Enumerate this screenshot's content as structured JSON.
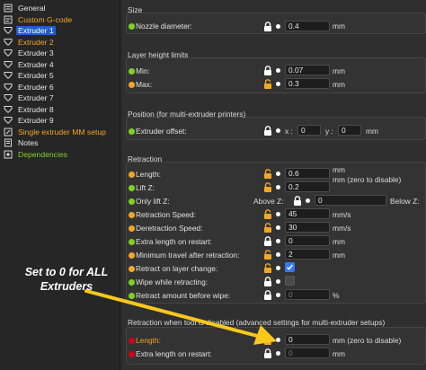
{
  "sidebar": {
    "items": [
      {
        "label": "General",
        "color": "#e6e6e6",
        "icon": "gear-icon"
      },
      {
        "label": "Custom G-code",
        "color": "#f5a623",
        "icon": "gcode-icon"
      },
      {
        "label": "Extruder 1",
        "color": "#ffffff",
        "icon": "extruder-icon",
        "selected": true
      },
      {
        "label": "Extruder 2",
        "color": "#f5a623",
        "icon": "extruder-icon"
      },
      {
        "label": "Extruder 3",
        "color": "#e6e6e6",
        "icon": "extruder-icon"
      },
      {
        "label": "Extruder 4",
        "color": "#e6e6e6",
        "icon": "extruder-icon"
      },
      {
        "label": "Extruder 5",
        "color": "#e6e6e6",
        "icon": "extruder-icon"
      },
      {
        "label": "Extruder 6",
        "color": "#e6e6e6",
        "icon": "extruder-icon"
      },
      {
        "label": "Extruder 7",
        "color": "#e6e6e6",
        "icon": "extruder-icon"
      },
      {
        "label": "Extruder 8",
        "color": "#e6e6e6",
        "icon": "extruder-icon"
      },
      {
        "label": "Extruder 9",
        "color": "#e6e6e6",
        "icon": "extruder-icon"
      },
      {
        "label": "Single extruder MM setup",
        "color": "#f5a623",
        "icon": "wrench-icon"
      },
      {
        "label": "Notes",
        "color": "#e6e6e6",
        "icon": "notes-icon"
      },
      {
        "label": "Dependencies",
        "color": "#7ed321",
        "icon": "dependencies-icon"
      }
    ]
  },
  "groups": {
    "size": {
      "title": "Size",
      "nozzle_label": "Nozzle diameter:",
      "nozzle_value": "0.4",
      "nozzle_unit": "mm"
    },
    "layer": {
      "title": "Layer height limits",
      "min_label": "Min:",
      "min_value": "0.07",
      "min_unit": "mm",
      "max_label": "Max:",
      "max_value": "0.3",
      "max_unit": "mm"
    },
    "position": {
      "title": "Position (for multi-extruder printers)",
      "offset_label": "Extruder offset:",
      "x_label": "x :",
      "x_value": "0",
      "y_label": "y :",
      "y_value": "0",
      "unit": "mm"
    },
    "retraction": {
      "title": "Retraction",
      "length_label": "Length:",
      "length_value": "0.6",
      "length_unit": "mm",
      "liftz_label": "Lift Z:",
      "liftz_value": "0.2",
      "liftz_unit": "mm (zero to disable)",
      "onlylift_label": "Only lift Z:",
      "above_label": "Above Z:",
      "above_value": "0",
      "below_label": "Below Z:",
      "speed_label": "Retraction Speed:",
      "speed_value": "45",
      "speed_unit": "mm/s",
      "deretract_label": "Deretraction Speed:",
      "deretract_value": "30",
      "deretract_unit": "mm/s",
      "extra_label": "Extra length on restart:",
      "extra_value": "0",
      "extra_unit": "mm",
      "travel_label": "Minimum travel after retraction:",
      "travel_value": "2",
      "travel_unit": "mm",
      "layerchange_label": "Retract on layer change:",
      "wipe_label": "Wipe while retracting:",
      "beforewipe_label": "Retract amount before wipe:",
      "beforewipe_value": "0",
      "beforewipe_unit": "%"
    },
    "toolchange": {
      "title": "Retraction when tool is disabled (advanced settings for multi-extruder setups)",
      "length_label": "Length:",
      "length_value": "0",
      "length_unit": "mm (zero to disable)",
      "extra_label": "Extra length on restart:",
      "extra_value": "0",
      "extra_unit": "mm"
    }
  },
  "annotation": {
    "text": "Set to 0 for ALL Extruders",
    "color": "#f8c81c"
  },
  "colors": {
    "selected": "#1f5bd6",
    "orange": "#f5a623",
    "green": "#7ed321",
    "red": "#d0021b",
    "checkbox_on": "#3478f6"
  }
}
